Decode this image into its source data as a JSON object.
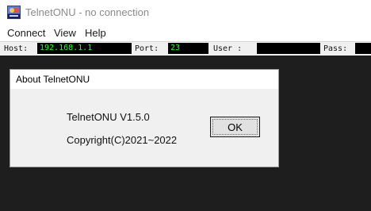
{
  "window": {
    "title": "TelnetONU - no connection",
    "icon": "telnet-app-icon"
  },
  "menu": [
    {
      "label": "Connect"
    },
    {
      "label": "View"
    },
    {
      "label": "Help"
    }
  ],
  "connection": {
    "host_label": "Host:",
    "host_value": "192.168.1.1",
    "port_label": "Port:",
    "port_value": "23",
    "user_label": "User :",
    "user_value": "",
    "pass_label": "Pass:",
    "pass_value": ""
  },
  "about_dialog": {
    "title": "About TelnetONU",
    "version": "TelnetONU V1.5.0",
    "copyright": "Copyright(C)2021~2022",
    "ok_label": "OK"
  },
  "colors": {
    "terminal_background": "#1e1e1e",
    "field_background": "#000000",
    "field_text": "#22ff22",
    "dialog_background": "#f0f0f0"
  }
}
